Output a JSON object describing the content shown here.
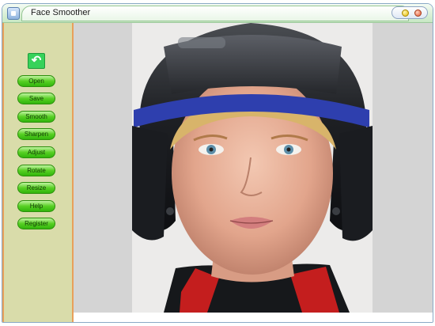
{
  "window": {
    "title": "Face Smoother"
  },
  "toolbar": {
    "undo_icon": "undo-arrow-icon",
    "buttons": [
      {
        "id": "open",
        "label": "Open"
      },
      {
        "id": "save",
        "label": "Save"
      },
      {
        "id": "smooth",
        "label": "Smooth"
      },
      {
        "id": "sharpen",
        "label": "Sharpen"
      },
      {
        "id": "adjust",
        "label": "Adjust"
      },
      {
        "id": "rotate",
        "label": "Rotate"
      },
      {
        "id": "resize",
        "label": "Resize"
      },
      {
        "id": "help",
        "label": "Help"
      },
      {
        "id": "register",
        "label": "Register"
      }
    ]
  },
  "colors": {
    "sidebar_bg": "#d9dcaa",
    "sidebar_border": "#e8a05a",
    "button_green": "#58d024",
    "canvas_bg": "#d4d4d4",
    "titlebar": "#dff2dc"
  },
  "canvas": {
    "image_subject": "helmet-portrait-photo"
  }
}
